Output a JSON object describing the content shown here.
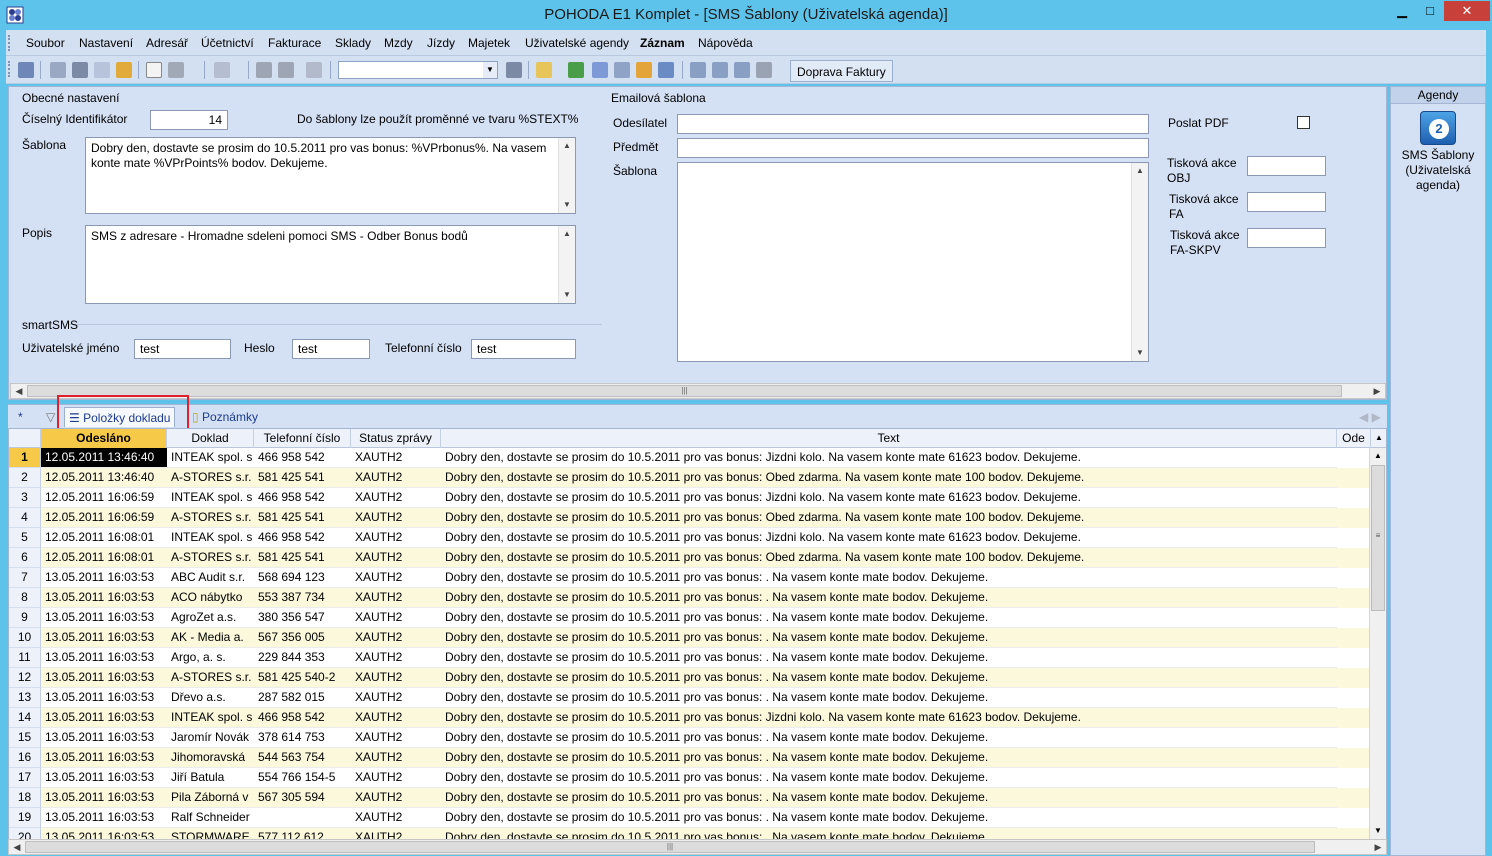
{
  "window": {
    "title": "POHODA E1 Komplet - [SMS Šablony (Uživatelská agenda)]",
    "minimize": "▁",
    "maximize": "□",
    "close": "✕"
  },
  "menu": [
    "Soubor",
    "Nastavení",
    "Adresář",
    "Účetnictví",
    "Fakturace",
    "Sklady",
    "Mzdy",
    "Jízdy",
    "Majetek",
    "Uživatelské agendy",
    "Záznam",
    "Nápověda"
  ],
  "toolbar": {
    "action_button": "Doprava Faktury",
    "combo_value": ""
  },
  "general": {
    "group_title": "Obecné nastavení",
    "id_label": "Číselný Identifikátor",
    "id_value": "14",
    "hint": "Do šablony lze použít proměnné ve tvaru %STEXT%",
    "template_label": "Šablona",
    "template_text": "Dobry den, dostavte se prosim do 10.5.2011 pro vas bonus: %VPrbonus%. Na vasem konte mate %VPrPoints% bodov. Dekujeme.",
    "desc_label": "Popis",
    "desc_text": "SMS z adresare - Hromadne sdeleni pomoci SMS - Odber Bonus bodů"
  },
  "smartsms": {
    "group_title": "smartSMS",
    "user_label": "Uživatelské jméno",
    "user_value": "test",
    "password_label": "Heslo",
    "password_value": "test",
    "phone_label": "Telefonní číslo",
    "phone_value": "test"
  },
  "email": {
    "group_title": "Emailová šablona",
    "sender_label": "Odesílatel",
    "sender_value": "",
    "subject_label": "Předmět",
    "subject_value": "",
    "template_label": "Šablona",
    "template_value": "",
    "pdf_label": "Poslat PDF",
    "print_obj_label": "Tisková akce OBJ",
    "print_fa_label": "Tisková akce FA",
    "print_faskpv_label": "Tisková akce FA-SKPV"
  },
  "agendy": {
    "header": "Agendy",
    "item_label": "SMS Šablony (Uživatelská agenda)"
  },
  "tabs": {
    "star": "*",
    "items": "Položky dokladu",
    "notes": "Poznámky"
  },
  "grid": {
    "columns": [
      "Odesláno",
      "Doklad",
      "Telefonní číslo",
      "Status zprávy",
      "Text",
      "Ode"
    ],
    "rows": [
      [
        "1",
        "12.05.2011 13:46:40",
        "INTEAK spol. s",
        "466 958 542",
        "XAUTH2",
        "Dobry den, dostavte se prosim do 10.5.2011 pro vas bonus: Jizdni kolo. Na vasem konte mate 61623 bodov. Dekujeme."
      ],
      [
        "2",
        "12.05.2011 13:46:40",
        "A-STORES s.r.",
        "581 425 541",
        "XAUTH2",
        "Dobry den, dostavte se prosim do 10.5.2011 pro vas bonus: Obed zdarma. Na vasem konte mate 100 bodov. Dekujeme."
      ],
      [
        "3",
        "12.05.2011 16:06:59",
        "INTEAK spol. s",
        "466 958 542",
        "XAUTH2",
        "Dobry den, dostavte se prosim do 10.5.2011 pro vas bonus: Jizdni kolo. Na vasem konte mate 61623 bodov. Dekujeme."
      ],
      [
        "4",
        "12.05.2011 16:06:59",
        "A-STORES s.r.",
        "581 425 541",
        "XAUTH2",
        "Dobry den, dostavte se prosim do 10.5.2011 pro vas bonus: Obed zdarma. Na vasem konte mate 100 bodov. Dekujeme."
      ],
      [
        "5",
        "12.05.2011 16:08:01",
        "INTEAK spol. s",
        "466 958 542",
        "XAUTH2",
        "Dobry den, dostavte se prosim do 10.5.2011 pro vas bonus: Jizdni kolo. Na vasem konte mate 61623 bodov. Dekujeme."
      ],
      [
        "6",
        "12.05.2011 16:08:01",
        "A-STORES s.r.",
        "581 425 541",
        "XAUTH2",
        "Dobry den, dostavte se prosim do 10.5.2011 pro vas bonus: Obed zdarma. Na vasem konte mate 100 bodov. Dekujeme."
      ],
      [
        "7",
        "13.05.2011 16:03:53",
        "ABC Audit s.r.",
        "568 694 123",
        "XAUTH2",
        "Dobry den, dostavte se prosim do 10.5.2011 pro vas bonus:  . Na vasem konte mate  bodov. Dekujeme."
      ],
      [
        "8",
        "13.05.2011 16:03:53",
        "ACO nábytko",
        "553 387 734",
        "XAUTH2",
        "Dobry den, dostavte se prosim do 10.5.2011 pro vas bonus:  . Na vasem konte mate  bodov. Dekujeme."
      ],
      [
        "9",
        "13.05.2011 16:03:53",
        "AgroZet a.s.",
        "380 356 547",
        "XAUTH2",
        "Dobry den, dostavte se prosim do 10.5.2011 pro vas bonus:  . Na vasem konte mate  bodov. Dekujeme."
      ],
      [
        "10",
        "13.05.2011 16:03:53",
        "AK - Media a.",
        "567 356 005",
        "XAUTH2",
        "Dobry den, dostavte se prosim do 10.5.2011 pro vas bonus:  . Na vasem konte mate  bodov. Dekujeme."
      ],
      [
        "11",
        "13.05.2011 16:03:53",
        "Argo, a. s.",
        "229 844 353",
        "XAUTH2",
        "Dobry den, dostavte se prosim do 10.5.2011 pro vas bonus:  . Na vasem konte mate  bodov. Dekujeme."
      ],
      [
        "12",
        "13.05.2011 16:03:53",
        "A-STORES s.r.",
        "581 425 540-2",
        "XAUTH2",
        "Dobry den, dostavte se prosim do 10.5.2011 pro vas bonus:  . Na vasem konte mate  bodov. Dekujeme."
      ],
      [
        "13",
        "13.05.2011 16:03:53",
        "Dřevo a.s.",
        "287 582 015",
        "XAUTH2",
        "Dobry den, dostavte se prosim do 10.5.2011 pro vas bonus:  . Na vasem konte mate  bodov. Dekujeme."
      ],
      [
        "14",
        "13.05.2011 16:03:53",
        "INTEAK spol. s",
        "466 958 542",
        "XAUTH2",
        "Dobry den, dostavte se prosim do 10.5.2011 pro vas bonus: Jizdni kolo. Na vasem konte mate 61623 bodov. Dekujeme."
      ],
      [
        "15",
        "13.05.2011 16:03:53",
        "Jaromír Novák",
        "378 614 753",
        "XAUTH2",
        "Dobry den, dostavte se prosim do 10.5.2011 pro vas bonus:  . Na vasem konte mate  bodov. Dekujeme."
      ],
      [
        "16",
        "13.05.2011 16:03:53",
        "Jihomoravská",
        "544 563 754",
        "XAUTH2",
        "Dobry den, dostavte se prosim do 10.5.2011 pro vas bonus:  . Na vasem konte mate  bodov. Dekujeme."
      ],
      [
        "17",
        "13.05.2011 16:03:53",
        "Jiří Batula",
        "554 766 154-5",
        "XAUTH2",
        "Dobry den, dostavte se prosim do 10.5.2011 pro vas bonus:  . Na vasem konte mate  bodov. Dekujeme."
      ],
      [
        "18",
        "13.05.2011 16:03:53",
        "Pila Záborná v",
        "567 305 594",
        "XAUTH2",
        "Dobry den, dostavte se prosim do 10.5.2011 pro vas bonus:  . Na vasem konte mate  bodov. Dekujeme."
      ],
      [
        "19",
        "13.05.2011 16:03:53",
        "Ralf Schneider",
        "",
        "XAUTH2",
        "Dobry den, dostavte se prosim do 10.5.2011 pro vas bonus:  . Na vasem konte mate  bodov. Dekujeme."
      ],
      [
        "20",
        "13.05.2011 16:03:53",
        "STORMWARE",
        "577 112 612",
        "XAUTH2",
        "Dobry den, dostavte se prosim do 10.5.2011 pro vas bonus:  . Na vasem konte mate  bodov. Dekujeme."
      ]
    ]
  },
  "colors": {
    "titlebar": "#5ec3ea",
    "panel": "#d4e0f3",
    "selected": "#f7c948",
    "alt_row": "#fbf8dc",
    "highlight": "#e0202a"
  }
}
